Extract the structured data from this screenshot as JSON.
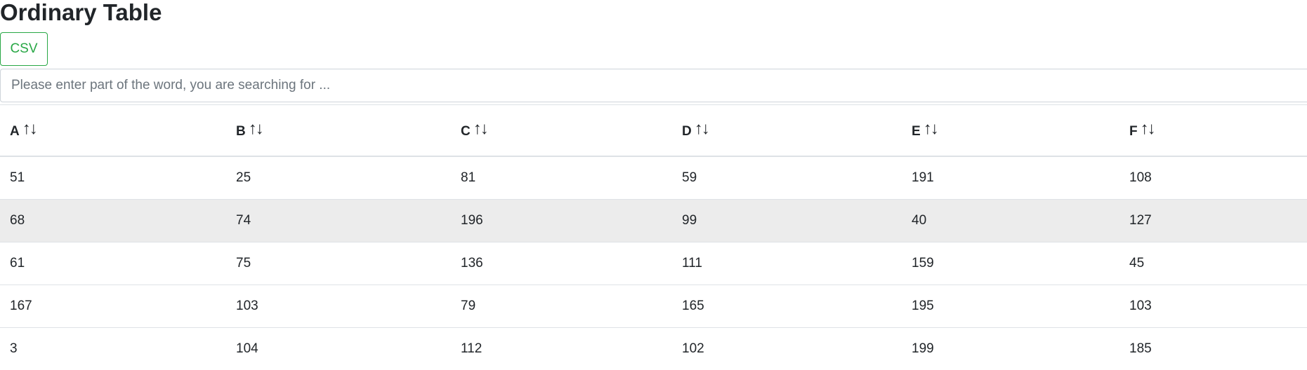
{
  "page": {
    "title": "Ordinary Table"
  },
  "toolbar": {
    "csv_label": "CSV"
  },
  "search": {
    "placeholder": "Please enter part of the word, you are searching for ...",
    "value": ""
  },
  "table": {
    "sort_icon": "↑↓",
    "columns": [
      "A",
      "B",
      "C",
      "D",
      "E",
      "F"
    ],
    "rows": [
      [
        "51",
        "25",
        "81",
        "59",
        "191",
        "108"
      ],
      [
        "68",
        "74",
        "196",
        "99",
        "40",
        "127"
      ],
      [
        "61",
        "75",
        "136",
        "111",
        "159",
        "45"
      ],
      [
        "167",
        "103",
        "79",
        "165",
        "195",
        "103"
      ],
      [
        "3",
        "104",
        "112",
        "102",
        "199",
        "185"
      ]
    ]
  },
  "colors": {
    "accent": "#28a745",
    "stripe": "#ececec"
  }
}
